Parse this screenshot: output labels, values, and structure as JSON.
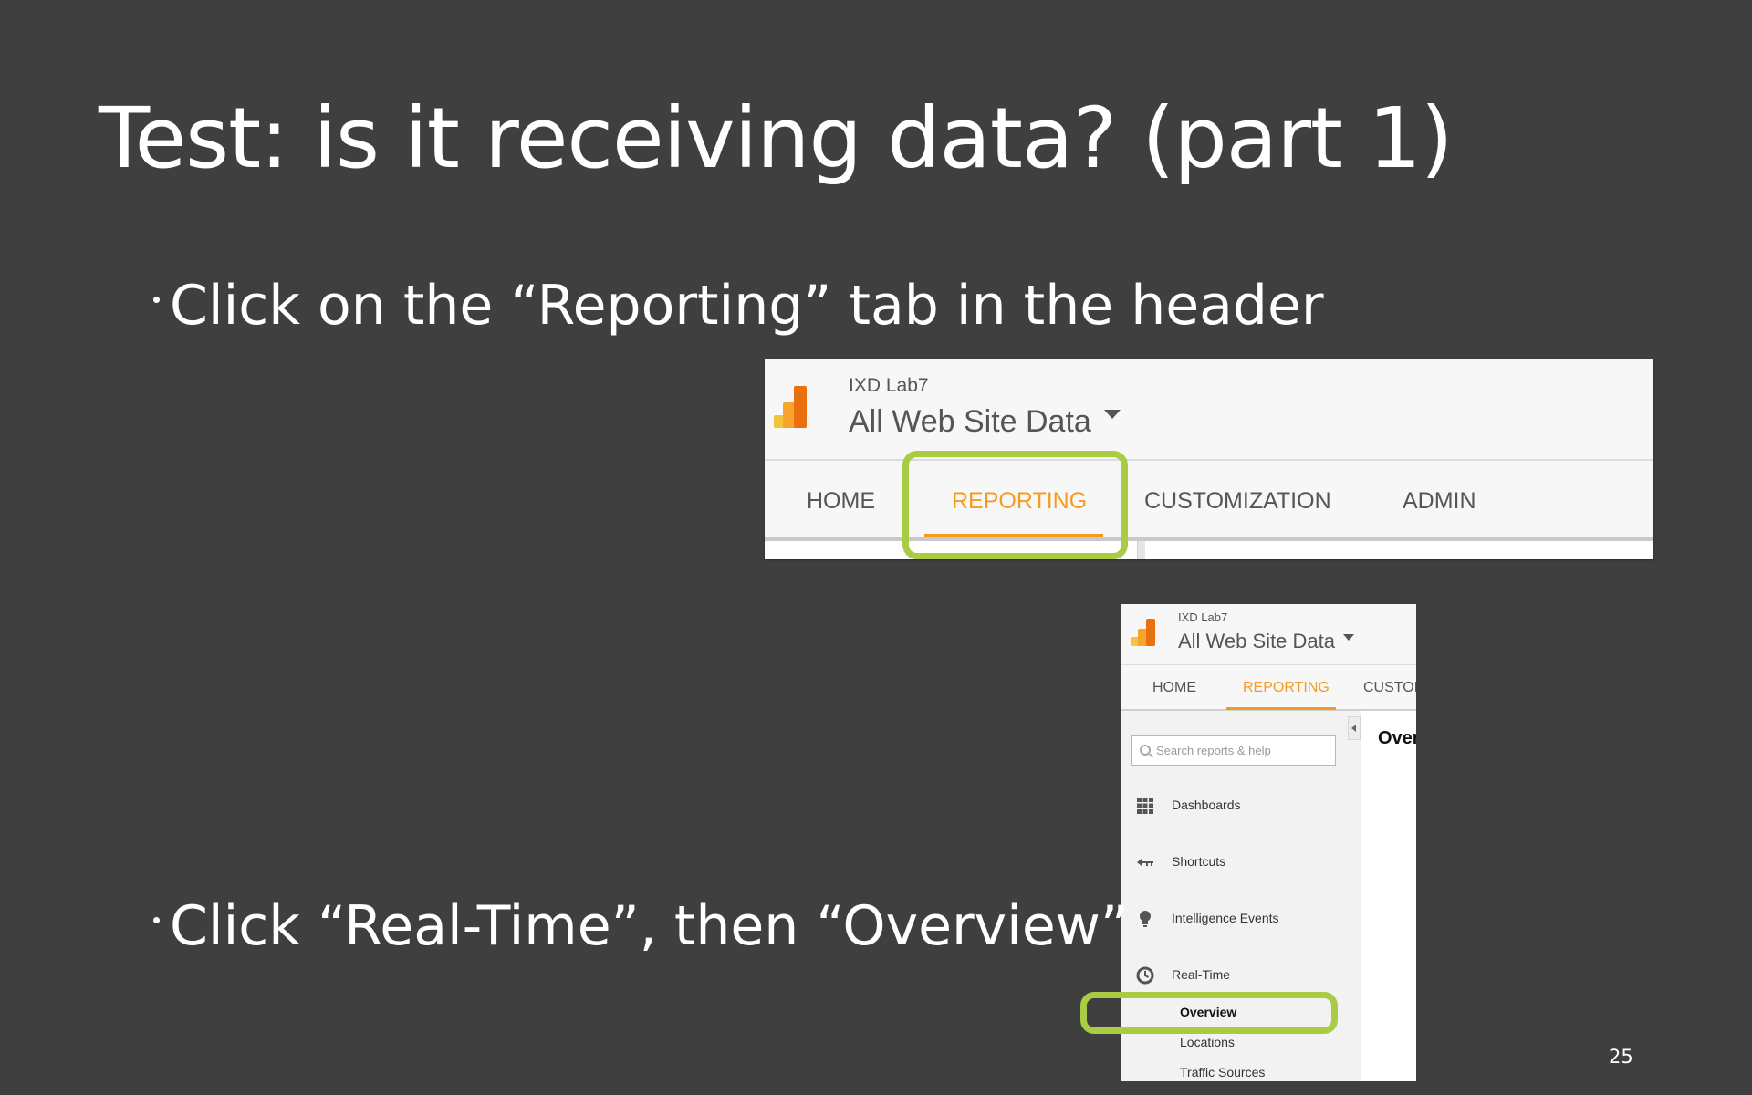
{
  "slide": {
    "title": "Test: is it receiving data? (part 1)",
    "bullets": [
      "Click on the “Reporting” tab in the header",
      "Click “Real-Time”, then “Overview”"
    ],
    "page_number": "25"
  },
  "screenshot_header": {
    "account": "IXD Lab7",
    "property": "All Web Site Data",
    "tabs": [
      {
        "label": "HOME",
        "active": false
      },
      {
        "label": "REPORTING",
        "active": true
      },
      {
        "label": "CUSTOMIZATION",
        "active": false
      },
      {
        "label": "ADMIN",
        "active": false
      }
    ]
  },
  "screenshot_sidebar": {
    "account": "IXD Lab7",
    "property": "All Web Site Data",
    "tabs": [
      {
        "label": "HOME",
        "active": false
      },
      {
        "label": "REPORTING",
        "active": true
      },
      {
        "label": "CUSTOM",
        "active": false
      }
    ],
    "search_placeholder": "Search reports & help",
    "nav_items": [
      {
        "label": "Dashboards",
        "icon": "dashboards-grid-icon"
      },
      {
        "label": "Shortcuts",
        "icon": "shortcuts-arrow-icon"
      },
      {
        "label": "Intelligence Events",
        "icon": "lightbulb-icon"
      },
      {
        "label": "Real-Time",
        "icon": "clock-icon"
      }
    ],
    "sub_items": [
      "Overview",
      "Locations",
      "Traffic Sources"
    ],
    "content_title": "Over"
  },
  "colors": {
    "background": "#3f3f3f",
    "accent_orange": "#f39c23",
    "highlight_green": "#a8cc44"
  }
}
